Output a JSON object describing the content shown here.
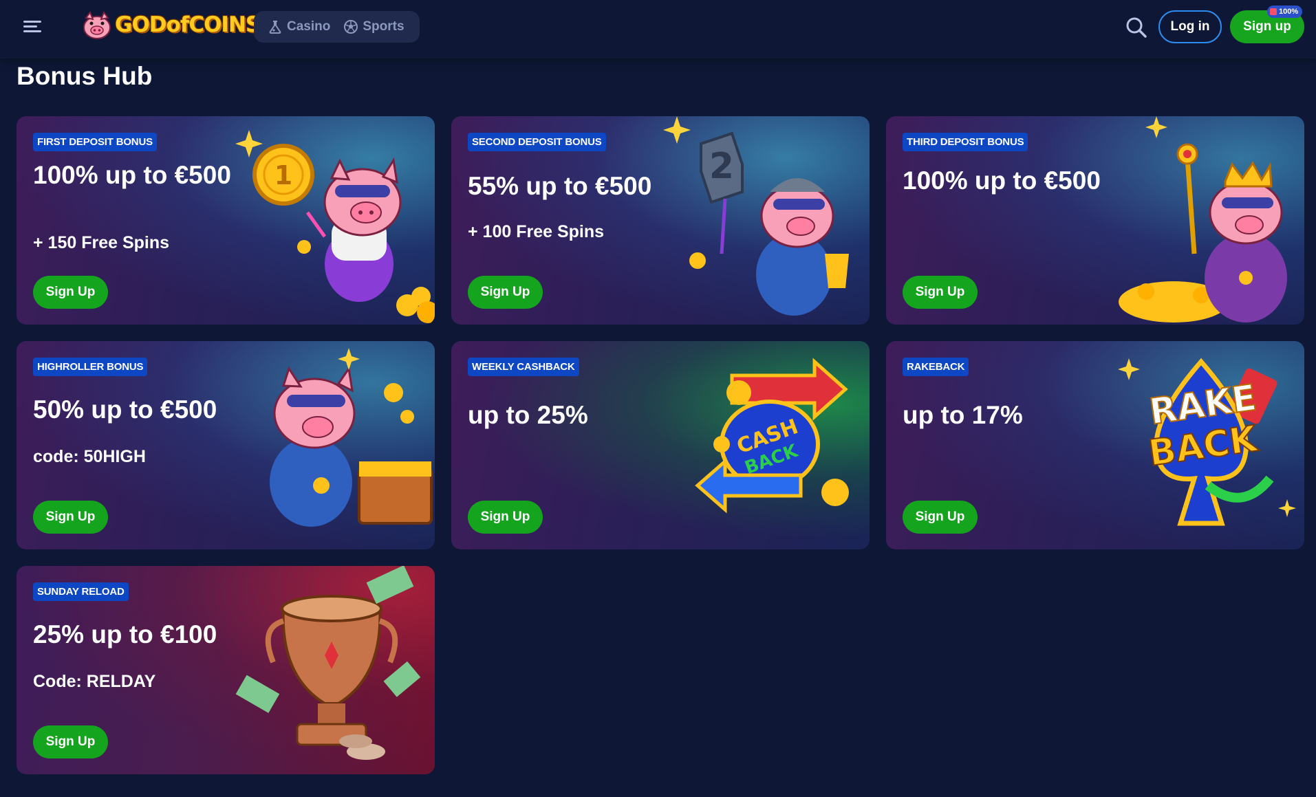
{
  "header": {
    "logo_text": "GODofCOINS",
    "modes": [
      {
        "label": "Casino",
        "icon": "flask-icon"
      },
      {
        "label": "Sports",
        "icon": "soccer-ball-icon"
      }
    ],
    "login_label": "Log in",
    "signup_label": "Sign up",
    "signup_badge": "100%"
  },
  "page": {
    "title": "Bonus Hub"
  },
  "cards": [
    {
      "badge": "FIRST DEPOSIT BONUS",
      "headline": "100% up to €500",
      "sub": "+ 150 Free Spins",
      "cta": "Sign Up",
      "art": "pig-with-gold-coin"
    },
    {
      "badge": "SECOND DEPOSIT BONUS",
      "headline": "55% up to €500",
      "sub": "+ 100 Free Spins",
      "cta": "Sign Up",
      "art": "pig-knight-with-number-2"
    },
    {
      "badge": "THIRD DEPOSIT BONUS",
      "headline": "100% up to €500",
      "sub": "",
      "cta": "Sign Up",
      "art": "pig-king-with-scepter"
    },
    {
      "badge": "HIGHROLLER BONUS",
      "headline": "50% up to €500",
      "sub": "code: 50HIGH",
      "cta": "Sign Up",
      "art": "pig-with-treasure-chest"
    },
    {
      "badge": "WEEKLY CASHBACK",
      "headline": "up to 25%",
      "sub": "",
      "cta": "Sign Up",
      "art": "cashback-emblem"
    },
    {
      "badge": "RAKEBACK",
      "headline": "up to 17%",
      "sub": "",
      "cta": "Sign Up",
      "art": "rakeback-emblem"
    },
    {
      "badge": "SUNDAY RELOAD",
      "headline": "25% up to €100",
      "sub": "Code: RELDAY",
      "cta": "Sign Up",
      "art": "trophy-with-coins"
    }
  ],
  "colors": {
    "background": "#0e1836",
    "badge": "#0e47c4",
    "cta_green": "#15a41d",
    "login_border": "#2d8cf0",
    "coin_gold": "#ffc21a"
  }
}
